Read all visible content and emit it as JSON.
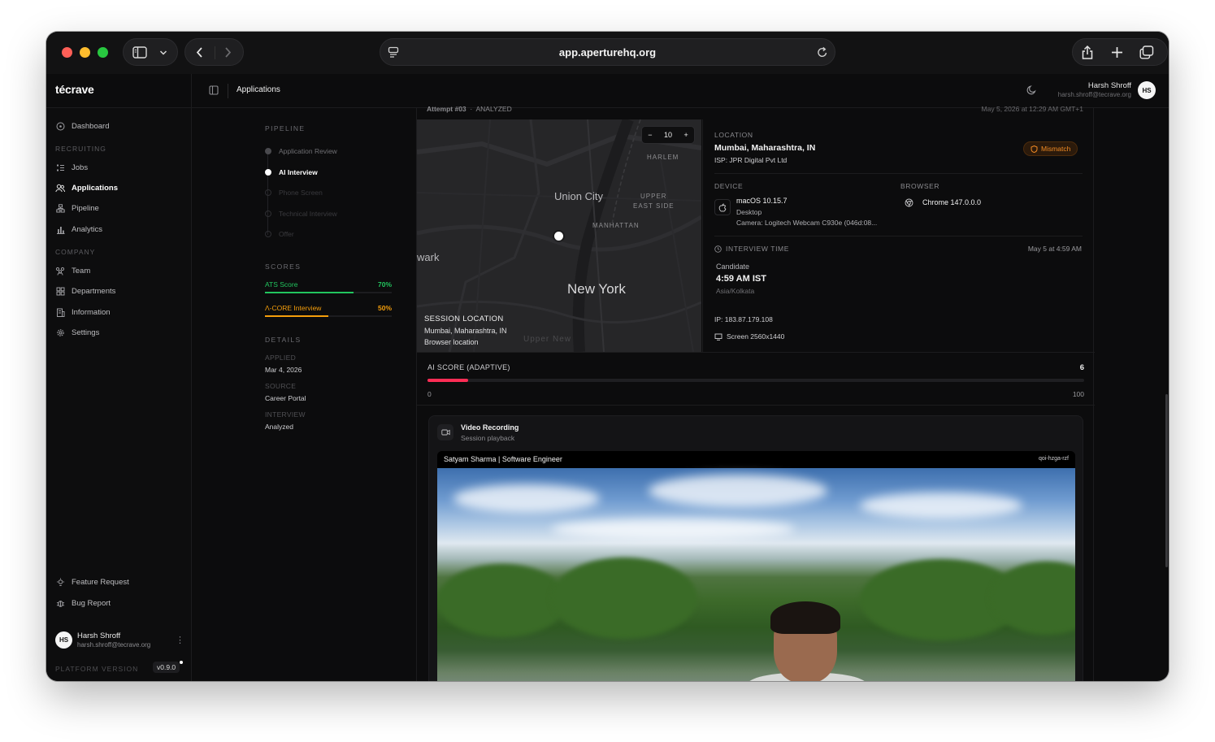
{
  "browser": {
    "url": "app.aperturehq.org"
  },
  "app": {
    "brand": "técrave",
    "breadcrumb": "Applications",
    "user": {
      "name": "Harsh Shroff",
      "email": "harsh.shroff@tecrave.org",
      "initials": "HS"
    }
  },
  "sidebar": {
    "dashboard": "Dashboard",
    "sections": {
      "recruiting": "RECRUITING",
      "company": "COMPANY"
    },
    "recruiting_items": [
      "Jobs",
      "Applications",
      "Pipeline",
      "Analytics"
    ],
    "company_items": [
      "Team",
      "Departments",
      "Information",
      "Settings"
    ],
    "footer_items": [
      "Feature Request",
      "Bug Report"
    ],
    "platform_label": "PLATFORM VERSION",
    "version": "v0.9.0"
  },
  "pipeline": {
    "title": "PIPELINE",
    "steps": [
      "Application Review",
      "AI Interview",
      "Phone Screen",
      "Technical Interview",
      "Offer"
    ],
    "active_step": "AI Interview"
  },
  "scores": {
    "title": "SCORES",
    "items": [
      {
        "label": "ATS Score",
        "value": "70%",
        "fraction": 0.7,
        "color": "#22c55e"
      },
      {
        "label": "Λ-CORE Interview",
        "value": "50%",
        "fraction": 0.5,
        "color": "#f59e0b"
      }
    ]
  },
  "details": {
    "title": "DETAILS",
    "applied_label": "APPLIED",
    "applied": "Mar 4, 2026",
    "source_label": "SOURCE",
    "source": "Career Portal",
    "interview_label": "INTERVIEW",
    "interview": "Analyzed"
  },
  "attempt": {
    "title": "Attempt #03",
    "status": "ANALYZED",
    "timestamp": "May 5, 2026 at 12:29 AM GMT+1"
  },
  "map": {
    "zoom": "10",
    "zoom_minus": "−",
    "zoom_plus": "+",
    "labels": {
      "harlem": "HARLEM",
      "union_city": "Union City",
      "upper_east": "UPPER",
      "upper_east_2": "EAST SIDE",
      "manhattan": "MANHATTAN",
      "newark": "wark",
      "new_york": "New York",
      "upper_new": "Upper New"
    },
    "caption_title": "SESSION LOCATION",
    "caption_place": "Mumbai, Maharashtra, IN",
    "caption_source": "Browser location"
  },
  "session": {
    "location_label": "LOCATION",
    "location": "Mumbai, Maharashtra, IN",
    "isp": "ISP: JPR Digital Pvt Ltd",
    "mismatch": "Mismatch",
    "device_label": "DEVICE",
    "device_os": "macOS 10.15.7",
    "device_type": "Desktop",
    "device_camera": "Camera: Logitech Webcam C930e (046d:08...",
    "browser_label": "BROWSER",
    "browser": "Chrome 147.0.0.0",
    "interview_time_label": "INTERVIEW TIME",
    "interview_time_date": "May 5 at 4:59 AM",
    "candidate_label": "Candidate",
    "candidate_time": "4:59 AM IST",
    "candidate_tz": "Asia/Kolkata",
    "ip": "IP: 183.87.179.108",
    "screen": "Screen 2560x1440"
  },
  "ai_score": {
    "title": "AI SCORE (ADAPTIVE)",
    "value": "6",
    "fraction": 0.06,
    "min": "0",
    "max": "100"
  },
  "video": {
    "title": "Video Recording",
    "subtitle": "Session playback",
    "player_title": "Satyam Sharma | Software Engineer",
    "player_id": "qoi-hzga-rzf"
  }
}
